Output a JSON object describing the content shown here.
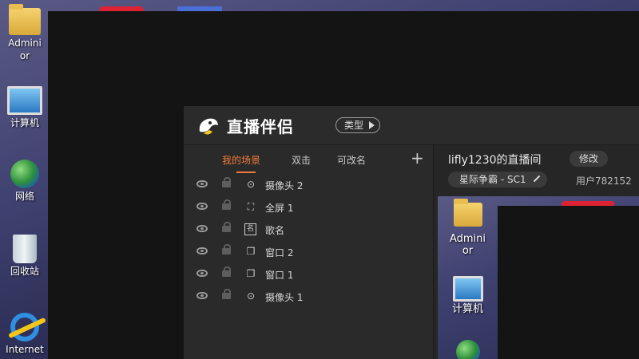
{
  "desktop": {
    "icons": [
      {
        "label": "Admini\nor"
      },
      {
        "label": "计算机"
      },
      {
        "label": "网络"
      },
      {
        "label": "回收站"
      },
      {
        "label": "Internet"
      }
    ]
  },
  "app": {
    "title": "直播伴侣",
    "type_button": "类型",
    "tabs": [
      {
        "label": "我的场景",
        "active": true
      },
      {
        "label": "双击"
      },
      {
        "label": "可改名"
      }
    ],
    "add_button": "+",
    "scenes": [
      {
        "type_icon": "camera-icon",
        "type_glyph": "⊙",
        "name": "摄像头 2"
      },
      {
        "type_icon": "fullscreen-icon",
        "type_glyph": "⛶",
        "name": "全屏 1"
      },
      {
        "type_icon": "text-icon",
        "type_glyph": "名",
        "name": "歌名"
      },
      {
        "type_icon": "window-icon",
        "type_glyph": "❐",
        "name": "窗口 2"
      },
      {
        "type_icon": "window-icon",
        "type_glyph": "❐",
        "name": "窗口 1"
      },
      {
        "type_icon": "camera-icon",
        "type_glyph": "⊙",
        "name": "摄像头 1"
      }
    ],
    "room": {
      "title": "lifly1230的直播间",
      "edit_button": "修改",
      "game_tag": "星际争霸 - SC1",
      "user": "用户782152"
    },
    "preview_icons": [
      {
        "label": "Admini\nor"
      },
      {
        "label": "计算机"
      }
    ]
  },
  "colors": {
    "accent": "#f37a3a",
    "app_bg": "#262626"
  }
}
